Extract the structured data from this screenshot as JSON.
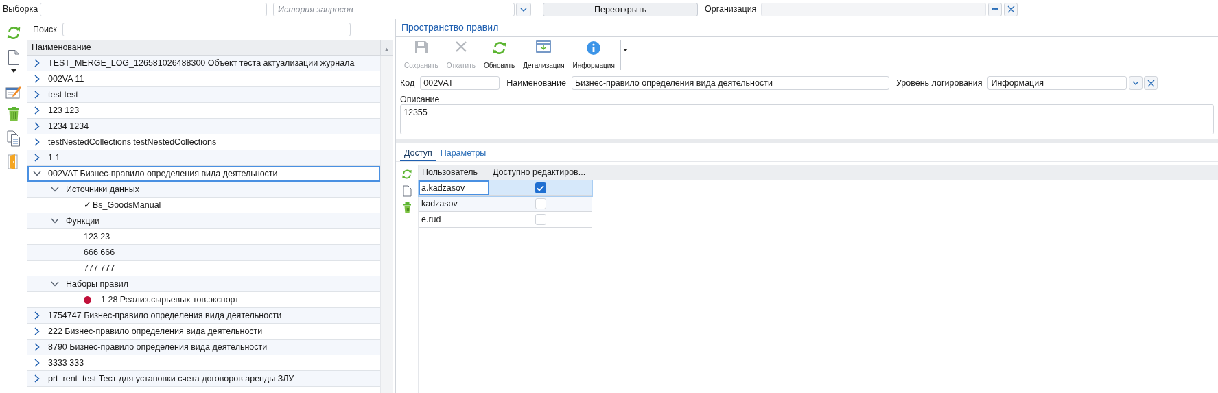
{
  "filter_bar": {
    "selection_label": "Выборка",
    "history_placeholder": "История запросов",
    "reopen_button": "Переоткрыть",
    "organization_label": "Организация",
    "more_button": "•••"
  },
  "tree": {
    "search_label": "Поиск",
    "column": "Наименование",
    "scroll_arrow": "▲",
    "items": [
      {
        "label": "TEST_MERGE_LOG_126581026488300 Объект теста актуализации журнала",
        "expanded": false,
        "selected": false
      },
      {
        "label": "002VA 11",
        "expanded": false,
        "selected": false
      },
      {
        "label": "test test",
        "expanded": false,
        "selected": false
      },
      {
        "label": "123 123",
        "expanded": false,
        "selected": false
      },
      {
        "label": "1234 1234",
        "expanded": false,
        "selected": false
      },
      {
        "label": "testNestedCollections testNestedCollections",
        "expanded": false,
        "selected": false
      },
      {
        "label": "1 1",
        "expanded": false,
        "selected": false
      },
      {
        "label": "002VAT Бизнес-правило определения вида деятельности",
        "expanded": true,
        "selected": true,
        "children": [
          {
            "label": "Источники данных",
            "expanded": true,
            "selected": false,
            "children": [
              {
                "label": "Bs_GoodsManual",
                "kind": "check",
                "mark": "✓",
                "selected": false
              }
            ]
          },
          {
            "label": "Функции",
            "expanded": true,
            "selected": false,
            "children": [
              {
                "label": "123 23",
                "kind": "plain",
                "selected": false
              },
              {
                "label": "666 666",
                "kind": "plain",
                "selected": false
              },
              {
                "label": "777 777",
                "kind": "plain",
                "selected": false
              }
            ]
          },
          {
            "label": "Наборы правил",
            "expanded": true,
            "selected": false,
            "children": [
              {
                "label": "1 28 Реализ.сырьевых тов.экспорт",
                "kind": "dot",
                "color": "#c0103a",
                "selected": false
              }
            ]
          }
        ]
      },
      {
        "label": "1754747 Бизнес-правило определения вида деятельности",
        "expanded": false,
        "selected": false
      },
      {
        "label": "222 Бизнес-правило определения вида деятельности",
        "expanded": false,
        "selected": false
      },
      {
        "label": "8790 Бизнес-правило определения вида деятельности",
        "expanded": false,
        "selected": false
      },
      {
        "label": "3333 333",
        "expanded": false,
        "selected": false
      },
      {
        "label": "prt_rent_test Тест для установки счета договоров аренды ЗЛУ",
        "expanded": false,
        "selected": false
      }
    ]
  },
  "panel": {
    "title": "Пространство правил",
    "toolbar": [
      {
        "label": "Сохранить",
        "kind": "save",
        "disabled": true
      },
      {
        "label": "Откатить",
        "kind": "cancel",
        "disabled": true
      },
      {
        "label": "Обновить",
        "kind": "refresh",
        "disabled": false
      },
      {
        "label": "Детализация",
        "kind": "details",
        "disabled": false
      },
      {
        "label": "Информация",
        "kind": "info",
        "disabled": false
      }
    ],
    "code_label": "Код",
    "code": "002VAT",
    "name_label": "Наименование",
    "name": "Бизнес-правило определения вида деятельности",
    "log_label": "Уровень логирования",
    "log_level": "Информация",
    "description_label": "Описание",
    "description": "12355",
    "tabs": [
      {
        "label": "Доступ",
        "selected": true
      },
      {
        "label": "Параметры",
        "selected": false
      }
    ],
    "table": {
      "columns": [
        "Пользователь",
        "Доступно редактиров..."
      ],
      "rows": [
        {
          "user": "a.kadzasov",
          "editable": true,
          "selected": true
        },
        {
          "user": "kadzasov",
          "editable": false,
          "selected": false
        },
        {
          "user": "e.rud",
          "editable": false,
          "selected": false
        }
      ]
    }
  }
}
